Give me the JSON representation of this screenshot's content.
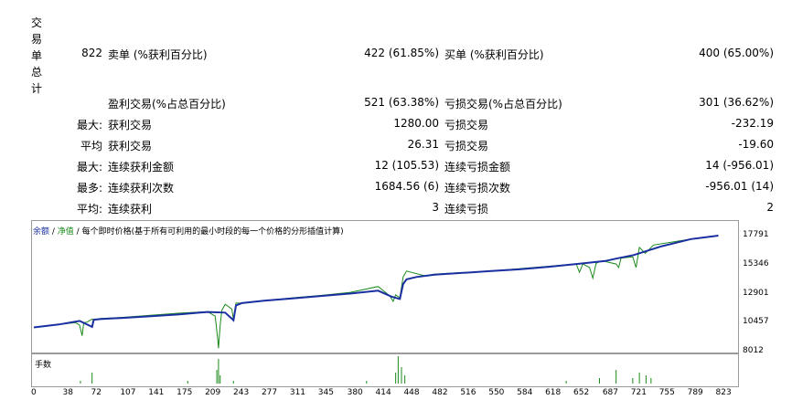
{
  "report": {
    "section_title_chars": [
      "交",
      "易",
      "单",
      "总",
      "计"
    ],
    "total_trades": "822",
    "short_label": "卖单 (%获利百分比)",
    "short_value": "422 (61.85%)",
    "long_label": "买单 (%获利百分比)",
    "long_value": "400 (65.00%)",
    "profit_trades_label": "盈利交易(%占总百分比)",
    "profit_trades_value": "521 (63.38%)",
    "loss_trades_label": "亏损交易(%占总百分比)",
    "loss_trades_value": "301 (36.62%)",
    "rows": [
      {
        "prefix": "最大:",
        "l_label": "获利交易",
        "l_value": "1280.00",
        "r_label": "亏损交易",
        "r_value": "-232.19"
      },
      {
        "prefix": "平均",
        "l_label": "获利交易",
        "l_value": "26.31",
        "r_label": "亏损交易",
        "r_value": "-19.60"
      },
      {
        "prefix": "最大:",
        "l_label": "连续获利金额",
        "l_value": "12 (105.53)",
        "r_label": "连续亏损金额",
        "r_value": "14 (-956.01)"
      },
      {
        "prefix": "最多:",
        "l_label": "连续获利次数",
        "l_value": "1684.56 (6)",
        "r_label": "连续亏损次数",
        "r_value": "-956.01 (14)"
      },
      {
        "prefix": "平均:",
        "l_label": "连续获利",
        "l_value": "3",
        "r_label": "连续亏损",
        "r_value": "2"
      }
    ]
  },
  "chart_header": {
    "balance": "余额",
    "sep1": " / ",
    "equity": "净值",
    "sep2": " / ",
    "desc": "每个即时价格(基于所有可利用的最小时段的每一个价格的分形插值计算)"
  },
  "volume_label": "手数",
  "chart_data": {
    "type": "line",
    "colors": {
      "balance": "#1a2fa0",
      "equity": "#1a8a1a",
      "volume": "#1a8a1a"
    },
    "y_ticks": [
      "17791",
      "15346",
      "12901",
      "10457",
      "8012"
    ],
    "ylim": [
      8012,
      17791
    ],
    "x_ticks": [
      "0",
      "38",
      "72",
      "107",
      "141",
      "175",
      "209",
      "243",
      "277",
      "311",
      "345",
      "380",
      "414",
      "448",
      "482",
      "516",
      "550",
      "584",
      "618",
      "652",
      "687",
      "721",
      "755",
      "789",
      "823"
    ],
    "xlim": [
      0,
      840
    ],
    "series": [
      {
        "key": "balance",
        "x": [
          0,
          30,
          55,
          70,
          72,
          80,
          107,
          141,
          175,
          200,
          209,
          230,
          240,
          243,
          250,
          277,
          311,
          345,
          380,
          414,
          430,
          440,
          444,
          448,
          460,
          482,
          516,
          550,
          584,
          618,
          652,
          687,
          700,
          721,
          755,
          790,
          823
        ],
        "y": [
          10050,
          10300,
          10600,
          10100,
          10700,
          10750,
          10850,
          11000,
          11150,
          11300,
          11350,
          11300,
          10650,
          11900,
          12100,
          12300,
          12500,
          12700,
          12900,
          13150,
          12650,
          12450,
          13700,
          14100,
          14300,
          14500,
          14650,
          14800,
          14950,
          15150,
          15400,
          15650,
          15850,
          16150,
          16900,
          17500,
          17791
        ]
      },
      {
        "key": "equity",
        "x": [
          0,
          50,
          55,
          58,
          60,
          64,
          70,
          72,
          80,
          107,
          175,
          209,
          218,
          221,
          222,
          224,
          226,
          230,
          238,
          240,
          243,
          250,
          311,
          345,
          380,
          414,
          428,
          432,
          435,
          440,
          444,
          448,
          470,
          482,
          550,
          618,
          652,
          656,
          660,
          668,
          672,
          676,
          680,
          684,
          700,
          703,
          706,
          720,
          724,
          728,
          735,
          745,
          790,
          823
        ],
        "y": [
          10050,
          10450,
          10250,
          9350,
          10450,
          10500,
          10750,
          10700,
          10800,
          10900,
          11250,
          11380,
          11000,
          9100,
          8300,
          10200,
          11500,
          12000,
          11600,
          10700,
          12100,
          12100,
          12550,
          12750,
          13000,
          13500,
          12700,
          12250,
          12800,
          12550,
          14300,
          14800,
          14400,
          14550,
          14800,
          15200,
          15400,
          14700,
          15400,
          15100,
          14200,
          15450,
          15600,
          15650,
          15400,
          15100,
          15900,
          16000,
          15100,
          16800,
          16300,
          17000,
          17500,
          17791
        ]
      }
    ],
    "volume": {
      "x": [
        56,
        70,
        185,
        220,
        222,
        224,
        240,
        400,
        435,
        438,
        442,
        446,
        640,
        680,
        700,
        720,
        728,
        736,
        742
      ],
      "y": [
        0.1,
        0.4,
        0.1,
        0.5,
        0.9,
        0.3,
        0.1,
        0.1,
        0.4,
        1.0,
        0.6,
        0.3,
        0.1,
        0.2,
        0.5,
        0.2,
        0.4,
        0.3,
        0.2
      ]
    }
  }
}
